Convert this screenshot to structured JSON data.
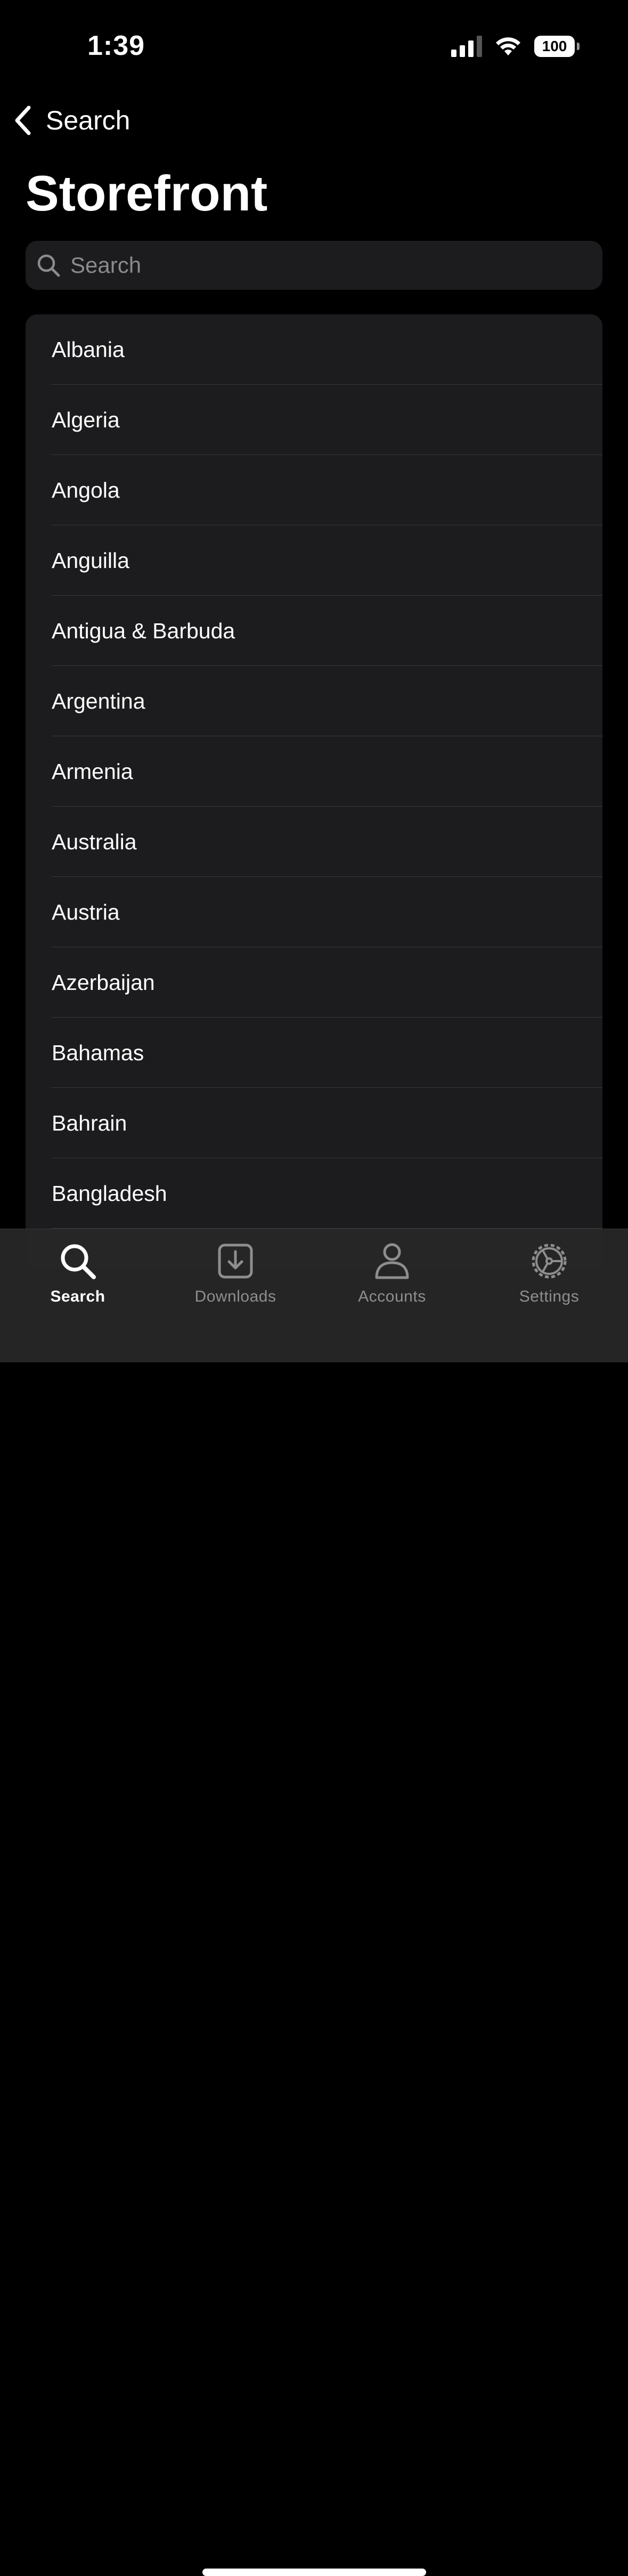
{
  "status_bar": {
    "time": "1:39",
    "battery": "100"
  },
  "nav": {
    "back_label": "Search",
    "title": "Storefront"
  },
  "search": {
    "placeholder": "Search"
  },
  "countries": [
    "Albania",
    "Algeria",
    "Angola",
    "Anguilla",
    "Antigua & Barbuda",
    "Argentina",
    "Armenia",
    "Australia",
    "Austria",
    "Azerbaijan",
    "Bahamas",
    "Bahrain",
    "Bangladesh"
  ],
  "tab_bar": {
    "tabs": [
      {
        "label": "Search",
        "icon": "magnifier-icon",
        "active": true
      },
      {
        "label": "Downloads",
        "icon": "download-icon",
        "active": false
      },
      {
        "label": "Accounts",
        "icon": "person-icon",
        "active": false
      },
      {
        "label": "Settings",
        "icon": "gear-icon",
        "active": false
      }
    ]
  },
  "colors": {
    "background": "#000000",
    "grouped_bg": "#1c1c1e",
    "separator": "#38383a",
    "inactive_tab": "#8e8e8e",
    "active_tab": "#ffffff"
  }
}
